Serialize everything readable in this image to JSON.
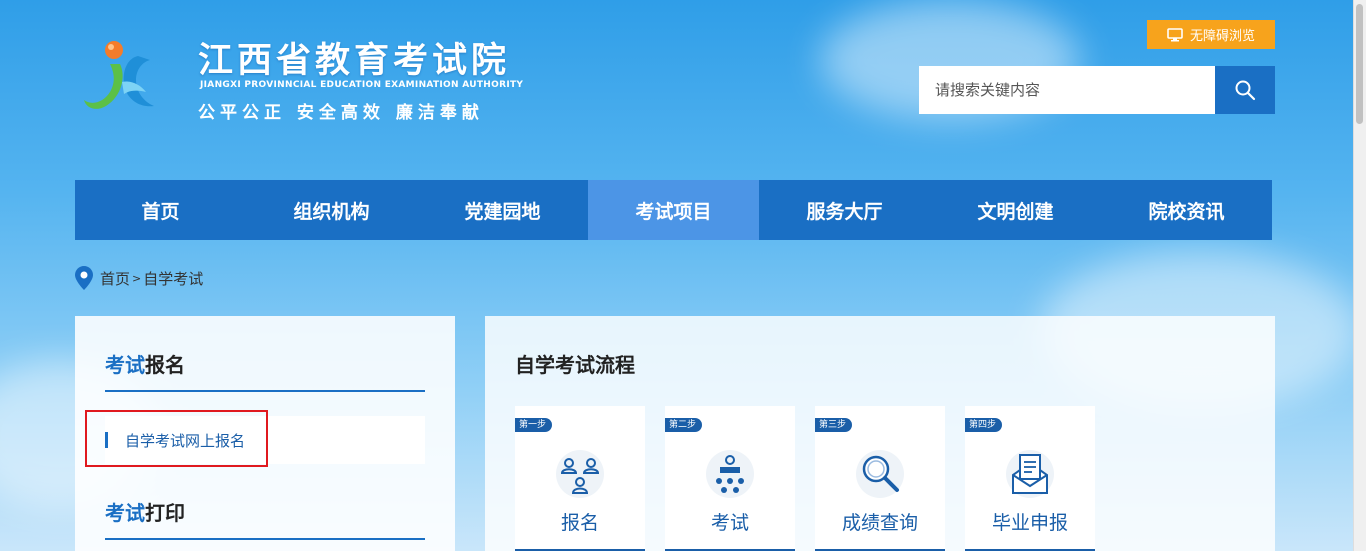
{
  "header": {
    "site_title": "江西省教育考试院",
    "site_subtitle": "JIANGXI PROVINNCIAL EDUCATION EXAMINATION AUTHORITY",
    "slogan": "公平公正  安全高效  廉洁奉献",
    "accessibility_label": "无障碍浏览",
    "search_placeholder": "请搜索关键内容"
  },
  "nav": {
    "items": [
      "首页",
      "组织机构",
      "党建园地",
      "考试项目",
      "服务大厅",
      "文明创建",
      "院校资讯"
    ],
    "active": "考试项目"
  },
  "breadcrumb": {
    "home": "首页",
    "separator": ">",
    "current": "自学考试"
  },
  "sidebar": {
    "section1": {
      "title_a": "考试",
      "title_b": "报名"
    },
    "link": "自学考试网上报名",
    "section2": {
      "title_a": "考试",
      "title_b": "打印"
    }
  },
  "main": {
    "title": "自学考试流程",
    "steps": [
      {
        "badge": "第一步",
        "label": "报名",
        "icon": "users-icon"
      },
      {
        "badge": "第二步",
        "label": "考试",
        "icon": "exam-icon"
      },
      {
        "badge": "第三步",
        "label": "成绩查询",
        "icon": "magnifier-icon"
      },
      {
        "badge": "第四步",
        "label": "毕业申报",
        "icon": "certificate-icon"
      }
    ]
  },
  "colors": {
    "primary": "#1a6fc4",
    "active_nav": "#4c95e6",
    "accent": "#f7a31c",
    "highlight_border": "#e0191f"
  }
}
